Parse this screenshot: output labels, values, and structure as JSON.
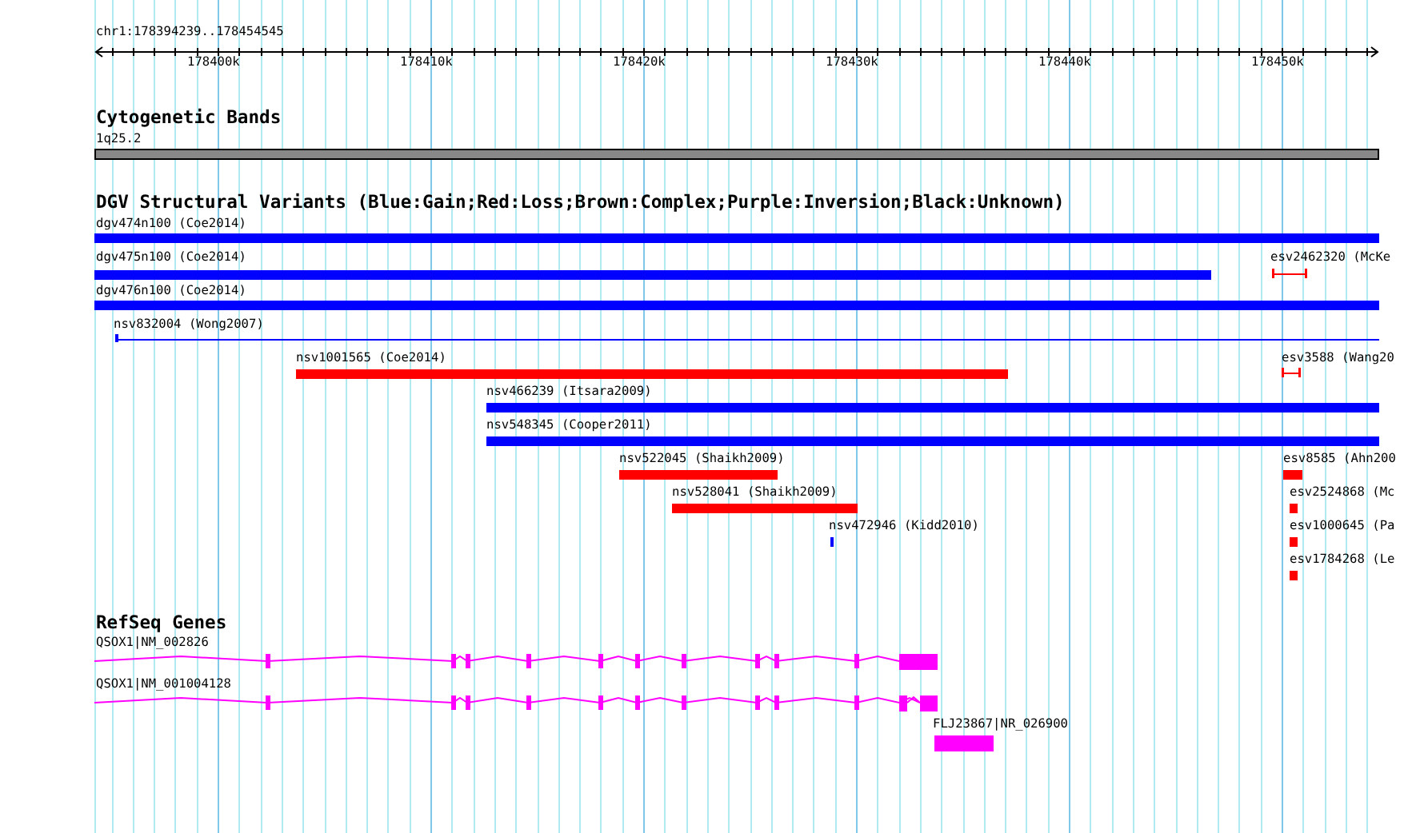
{
  "ruler": {
    "position": "chr1:178394239..178454545",
    "ticks": [
      "178400k",
      "178410k",
      "178420k",
      "178430k",
      "178440k",
      "178450k"
    ]
  },
  "tracks": [
    {
      "title": "Cytogenetic Bands",
      "kind": "bands",
      "features": [
        {
          "label": "1q25.2"
        }
      ]
    },
    {
      "title": "DGV Structural Variants (Blue:Gain;Red:Loss;Brown:Complex;Purple:Inversion;Black:Unknown)",
      "kind": "variants",
      "features": [
        {
          "label": "dgv474n100 (Coe2014)",
          "color": "#0000ff"
        },
        {
          "label": "dgv475n100 (Coe2014)",
          "color": "#0000ff"
        },
        {
          "label": "esv2462320 (McKe",
          "color": "#ff0000"
        },
        {
          "label": "dgv476n100 (Coe2014)",
          "color": "#0000ff"
        },
        {
          "label": "nsv832004 (Wong2007)",
          "color": "#0000ff"
        },
        {
          "label": "nsv1001565 (Coe2014)",
          "color": "#ff0000"
        },
        {
          "label": "esv3588 (Wang20",
          "color": "#ff0000"
        },
        {
          "label": "nsv466239 (Itsara2009)",
          "color": "#0000ff"
        },
        {
          "label": "nsv548345 (Cooper2011)",
          "color": "#0000ff"
        },
        {
          "label": "nsv522045 (Shaikh2009)",
          "color": "#ff0000"
        },
        {
          "label": "esv8585 (Ahn200",
          "color": "#ff0000"
        },
        {
          "label": "nsv528041 (Shaikh2009)",
          "color": "#ff0000"
        },
        {
          "label": "esv2524868 (Mc",
          "color": "#ff0000"
        },
        {
          "label": "nsv472946 (Kidd2010)",
          "color": "#0000ff"
        },
        {
          "label": "esv1000645 (Pa",
          "color": "#ff0000"
        },
        {
          "label": "esv1784268 (Le",
          "color": "#ff0000"
        }
      ]
    },
    {
      "title": "RefSeq Genes",
      "kind": "genes",
      "features": [
        {
          "label": "QSOX1|NM_002826"
        },
        {
          "label": "QSOX1|NM_001004128"
        },
        {
          "label": "FLJ23867|NR_026900"
        }
      ]
    }
  ]
}
